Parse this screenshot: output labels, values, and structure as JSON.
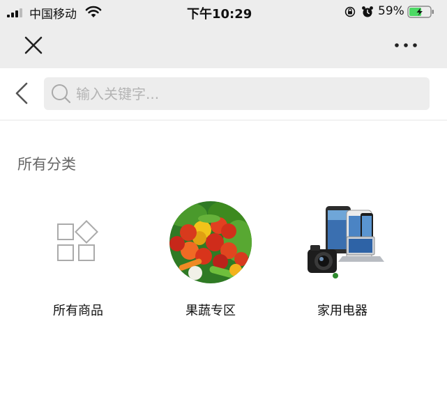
{
  "status_bar": {
    "carrier": "中国移动",
    "time": "下午10:29",
    "battery": "59%",
    "battery_level": 0.59,
    "battery_color": "#4cd964"
  },
  "nav": {
    "close_icon": "close-icon",
    "more_icon": "more-horizontal-icon"
  },
  "search": {
    "back_icon": "chevron-left-icon",
    "search_icon": "search-icon",
    "placeholder": "输入关键字..."
  },
  "section": {
    "title": "所有分类"
  },
  "categories": [
    {
      "label": "所有商品",
      "icon": "all-products-grid-icon"
    },
    {
      "label": "果蔬专区",
      "icon": "fruit-vegetable-image"
    },
    {
      "label": "家用电器",
      "icon": "home-appliance-image"
    }
  ]
}
